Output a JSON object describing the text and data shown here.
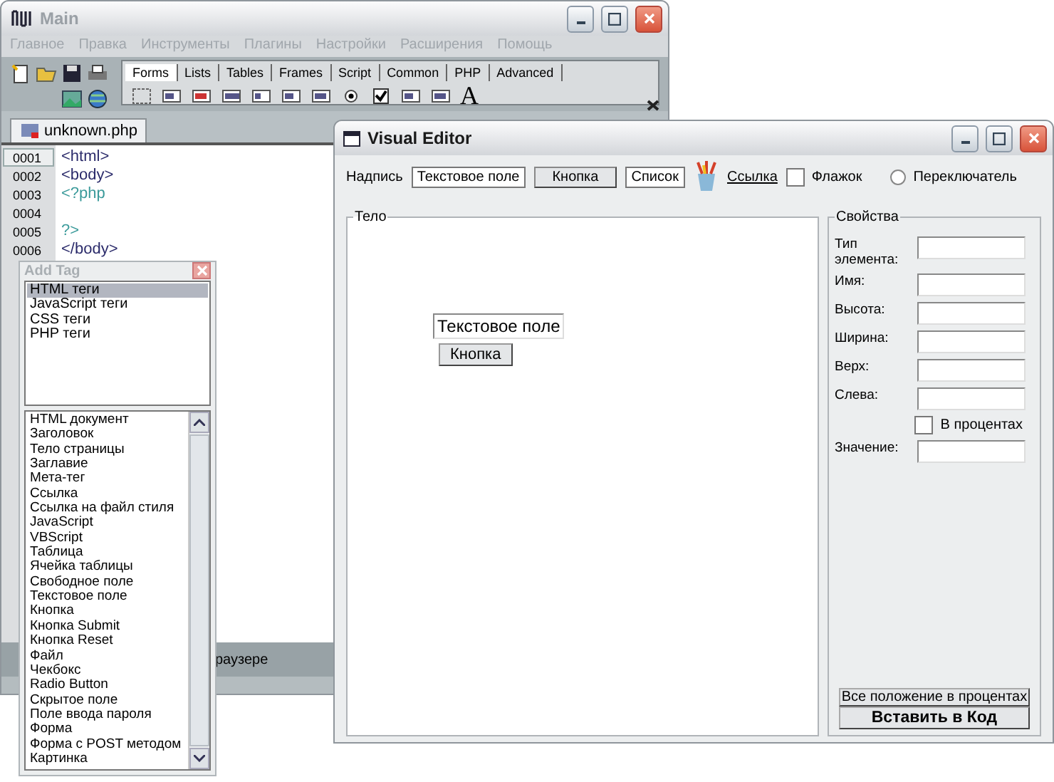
{
  "main_window": {
    "title": "Main",
    "menu": [
      "Главное",
      "Правка",
      "Инструменты",
      "Плагины",
      "Настройки",
      "Расширения",
      "Помощь"
    ],
    "toolbar_tabs": [
      {
        "label": "Forms",
        "selected": true
      },
      {
        "label": "Lists",
        "selected": false
      },
      {
        "label": "Tables",
        "selected": false
      },
      {
        "label": "Frames",
        "selected": false
      },
      {
        "label": "Script",
        "selected": false
      },
      {
        "label": "Common",
        "selected": false
      },
      {
        "label": "PHP",
        "selected": false
      },
      {
        "label": "Advanced",
        "selected": false
      }
    ],
    "font_glyph": "A",
    "document_tab": "unknown.php",
    "code_lines": [
      {
        "number": "0001",
        "text": "<html>",
        "kind": "tag",
        "selected": true
      },
      {
        "number": "0002",
        "text": "<body>",
        "kind": "tag",
        "selected": false
      },
      {
        "number": "0003",
        "text": "<?php",
        "kind": "php",
        "selected": false
      },
      {
        "number": "0004",
        "kind": "empty",
        "selected": false
      },
      {
        "number": "0005",
        "text": "?>",
        "kind": "php",
        "selected": false
      },
      {
        "number": "0006",
        "text": "</body>",
        "kind": "tag",
        "selected": false
      }
    ],
    "status_text": "раузере"
  },
  "add_tag": {
    "title": "Add Tag",
    "categories": [
      {
        "label": "HTML теги",
        "selected": true
      },
      {
        "label": "JavaScript теги",
        "selected": false
      },
      {
        "label": "CSS теги",
        "selected": false
      },
      {
        "label": "PHP теги",
        "selected": false
      }
    ],
    "tags": [
      "HTML документ",
      "Заголовок",
      "Тело страницы",
      "Заглавие",
      "Мета-тег",
      "Ссылка",
      "Ссылка на файл стиля",
      "JavaScript",
      "VBScript",
      "Таблица",
      "Ячейка таблицы",
      "Свободное поле",
      "Текстовое поле",
      "Кнопка",
      "Кнопка Submit",
      "Кнопка Reset",
      "Файл",
      "Чекбокс",
      "Radio Button",
      "Скрытое поле",
      "Поле ввода пароля",
      "Форма",
      "Форма с POST методом",
      "Картинка"
    ]
  },
  "visual_editor": {
    "title": "Visual Editor",
    "palette": [
      {
        "kind": "label",
        "text": "Надпись"
      },
      {
        "kind": "field",
        "text": "Текстовое поле"
      },
      {
        "kind": "button",
        "text": "Кнопка"
      },
      {
        "kind": "field",
        "text": "Список"
      },
      {
        "kind": "brushes"
      },
      {
        "kind": "link",
        "text": "Ссылка"
      },
      {
        "kind": "checkbox",
        "text": "Флажок",
        "checked": false
      },
      {
        "kind": "radio",
        "text": "Переключатель",
        "selected": false
      }
    ],
    "body": {
      "legend": "Тело",
      "elements": [
        {
          "kind": "field",
          "text": "Текстовое поле"
        },
        {
          "kind": "button",
          "text": "Кнопка"
        }
      ]
    },
    "properties": {
      "legend": "Свойства",
      "fields": [
        {
          "label": "Тип элемента:"
        },
        {
          "label": "Имя:"
        },
        {
          "label": "Высота:"
        },
        {
          "label": "Ширина:"
        },
        {
          "label": "Верх:"
        },
        {
          "label": "Слева:"
        }
      ],
      "percent_checkbox": {
        "label": "В процентах",
        "checked": false
      },
      "value_field": {
        "label": "Значение:"
      },
      "buttons": [
        {
          "label": "Все положение в процентах",
          "primary": false
        },
        {
          "label": "Вставить в Код",
          "primary": true
        }
      ]
    }
  }
}
